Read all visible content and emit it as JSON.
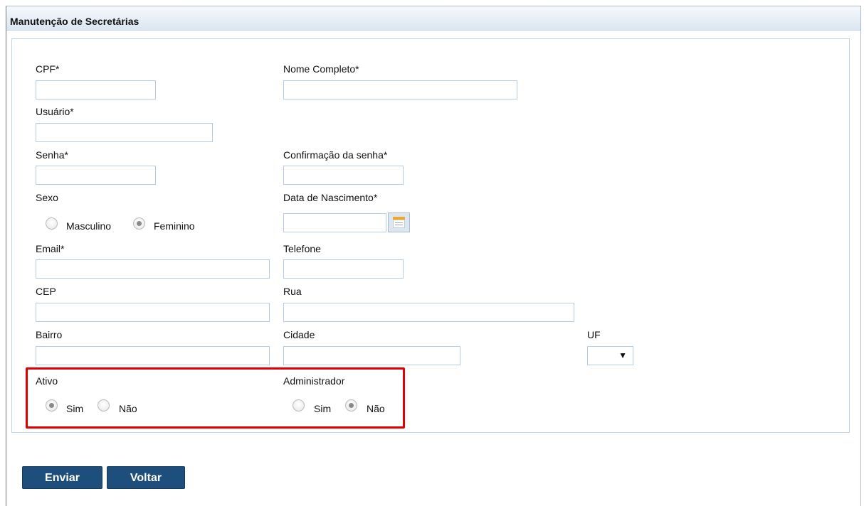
{
  "panel": {
    "title": "Manutenção de Secretárias"
  },
  "form": {
    "cpf_label": "CPF*",
    "nome_label": "Nome Completo*",
    "usuario_label": "Usuário*",
    "senha_label": "Senha*",
    "confirmacao_label": "Confirmação da senha*",
    "sexo_label": "Sexo",
    "sexo_options": [
      "Masculino",
      "Feminino"
    ],
    "sexo_selected": "Feminino",
    "nascimento_label": "Data de Nascimento*",
    "calendar_icon": "calendar-icon",
    "email_label": "Email*",
    "telefone_label": "Telefone",
    "cep_label": "CEP",
    "rua_label": "Rua",
    "bairro_label": "Bairro",
    "cidade_label": "Cidade",
    "uf_label": "UF",
    "uf_value": "",
    "ativo_label": "Ativo",
    "ativo_options": [
      "Sim",
      "Não"
    ],
    "ativo_selected": "Sim",
    "admin_label": "Administrador",
    "admin_options": [
      "Sim",
      "Não"
    ],
    "admin_selected": "Não"
  },
  "buttons": {
    "enviar": "Enviar",
    "voltar": "Voltar"
  },
  "colors": {
    "highlight": "#e00000",
    "button_bg": "#1e4f7c",
    "border": "#b7cde3"
  }
}
